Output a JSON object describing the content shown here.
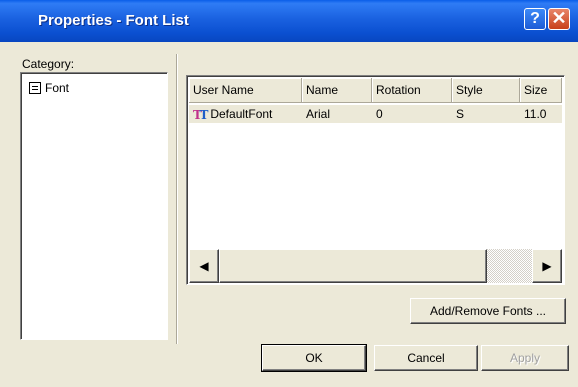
{
  "window": {
    "title": "Properties - Font List"
  },
  "titlebar": {
    "help_glyph": "?",
    "close_glyph": "✕"
  },
  "category": {
    "label": "Category:",
    "items": [
      {
        "label": "Font",
        "icon": "document-list-icon"
      }
    ]
  },
  "table": {
    "columns": [
      "User Name",
      "Name",
      "Rotation",
      "Style",
      "Size"
    ],
    "rows": [
      {
        "icon": "truetype-font-icon",
        "user_name": "DefaultFont",
        "name": "Arial",
        "rotation": "0",
        "style": "S",
        "size": "11.0"
      }
    ]
  },
  "scrollbar": {
    "left_arrow": "◀",
    "right_arrow": "▶"
  },
  "buttons": {
    "add_remove": "Add/Remove Fonts ...",
    "ok": "OK",
    "cancel": "Cancel",
    "apply": "Apply"
  },
  "colors": {
    "title_bar": "#1a61e0",
    "dialog_bg": "#ece9d8",
    "icon_pink": "#c0308a",
    "icon_blue": "#1e5ec8"
  }
}
